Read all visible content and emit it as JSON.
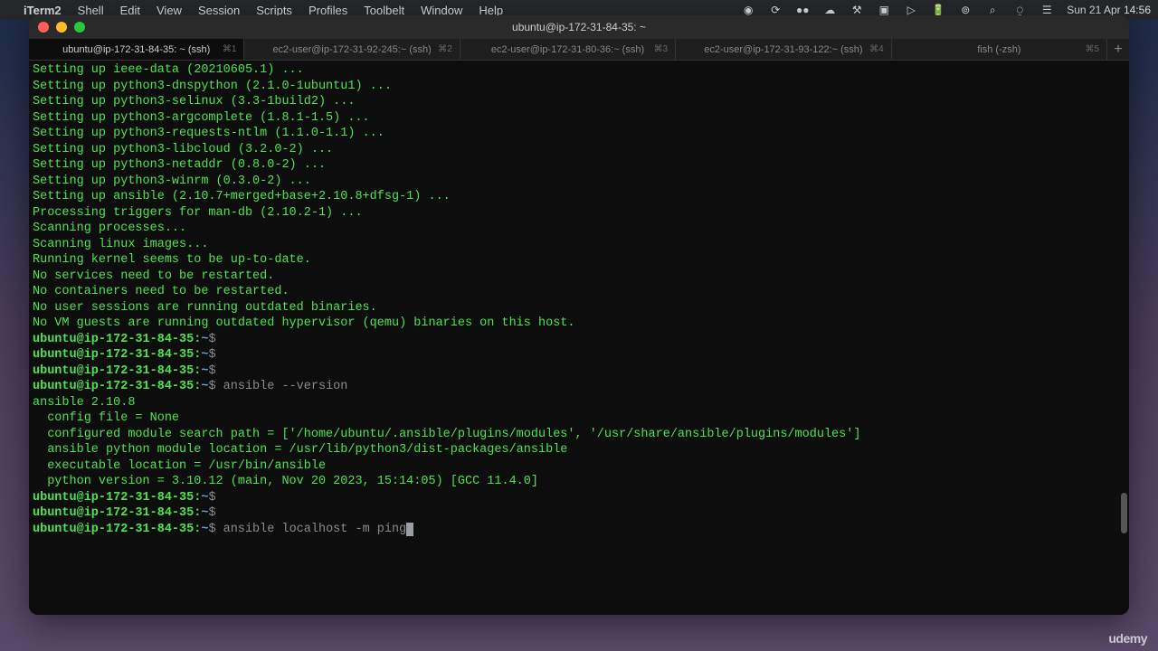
{
  "menubar": {
    "app": "iTerm2",
    "items": [
      "Shell",
      "Edit",
      "View",
      "Session",
      "Scripts",
      "Profiles",
      "Toolbelt",
      "Window",
      "Help"
    ],
    "clock": "Sun 21 Apr  14:56"
  },
  "window": {
    "title": "ubuntu@ip-172-31-84-35: ~"
  },
  "tabs": [
    {
      "label": "ubuntu@ip-172-31-84-35: ~ (ssh)",
      "shortcut": "⌘1",
      "active": true
    },
    {
      "label": "ec2-user@ip-172-31-92-245:~ (ssh)",
      "shortcut": "⌘2",
      "active": false
    },
    {
      "label": "ec2-user@ip-172-31-80-36:~ (ssh)",
      "shortcut": "⌘3",
      "active": false
    },
    {
      "label": "ec2-user@ip-172-31-93-122:~ (ssh)",
      "shortcut": "⌘4",
      "active": false
    },
    {
      "label": "fish (-zsh)",
      "shortcut": "⌘5",
      "active": false
    }
  ],
  "terminal": {
    "lines": [
      {
        "type": "output",
        "text": "Setting up ieee-data (20210605.1) ..."
      },
      {
        "type": "output",
        "text": "Setting up python3-dnspython (2.1.0-1ubuntu1) ..."
      },
      {
        "type": "output",
        "text": "Setting up python3-selinux (3.3-1build2) ..."
      },
      {
        "type": "output",
        "text": "Setting up python3-argcomplete (1.8.1-1.5) ..."
      },
      {
        "type": "output",
        "text": "Setting up python3-requests-ntlm (1.1.0-1.1) ..."
      },
      {
        "type": "output",
        "text": "Setting up python3-libcloud (3.2.0-2) ..."
      },
      {
        "type": "output",
        "text": "Setting up python3-netaddr (0.8.0-2) ..."
      },
      {
        "type": "output",
        "text": "Setting up python3-winrm (0.3.0-2) ..."
      },
      {
        "type": "output",
        "text": "Setting up ansible (2.10.7+merged+base+2.10.8+dfsg-1) ..."
      },
      {
        "type": "output",
        "text": "Processing triggers for man-db (2.10.2-1) ..."
      },
      {
        "type": "output",
        "text": "Scanning processes..."
      },
      {
        "type": "output",
        "text": "Scanning linux images..."
      },
      {
        "type": "output",
        "text": ""
      },
      {
        "type": "output",
        "text": "Running kernel seems to be up-to-date."
      },
      {
        "type": "output",
        "text": ""
      },
      {
        "type": "output",
        "text": "No services need to be restarted."
      },
      {
        "type": "output",
        "text": ""
      },
      {
        "type": "output",
        "text": "No containers need to be restarted."
      },
      {
        "type": "output",
        "text": ""
      },
      {
        "type": "output",
        "text": "No user sessions are running outdated binaries."
      },
      {
        "type": "output",
        "text": ""
      },
      {
        "type": "output",
        "text": "No VM guests are running outdated hypervisor (qemu) binaries on this host."
      },
      {
        "type": "prompt",
        "host": "ubuntu@ip-172-31-84-35",
        "cmd": ""
      },
      {
        "type": "prompt",
        "host": "ubuntu@ip-172-31-84-35",
        "cmd": ""
      },
      {
        "type": "prompt",
        "host": "ubuntu@ip-172-31-84-35",
        "cmd": ""
      },
      {
        "type": "prompt",
        "host": "ubuntu@ip-172-31-84-35",
        "cmd": "ansible --version"
      },
      {
        "type": "output",
        "text": "ansible 2.10.8"
      },
      {
        "type": "output",
        "text": "  config file = None"
      },
      {
        "type": "output",
        "text": "  configured module search path = ['/home/ubuntu/.ansible/plugins/modules', '/usr/share/ansible/plugins/modules']"
      },
      {
        "type": "output",
        "text": "  ansible python module location = /usr/lib/python3/dist-packages/ansible"
      },
      {
        "type": "output",
        "text": "  executable location = /usr/bin/ansible"
      },
      {
        "type": "output",
        "text": "  python version = 3.10.12 (main, Nov 20 2023, 15:14:05) [GCC 11.4.0]"
      },
      {
        "type": "prompt",
        "host": "ubuntu@ip-172-31-84-35",
        "cmd": ""
      },
      {
        "type": "prompt",
        "host": "ubuntu@ip-172-31-84-35",
        "cmd": ""
      },
      {
        "type": "prompt",
        "host": "ubuntu@ip-172-31-84-35",
        "cmd": "ansible localhost -m ping",
        "cursor": true
      }
    ]
  },
  "watermark": "udemy"
}
